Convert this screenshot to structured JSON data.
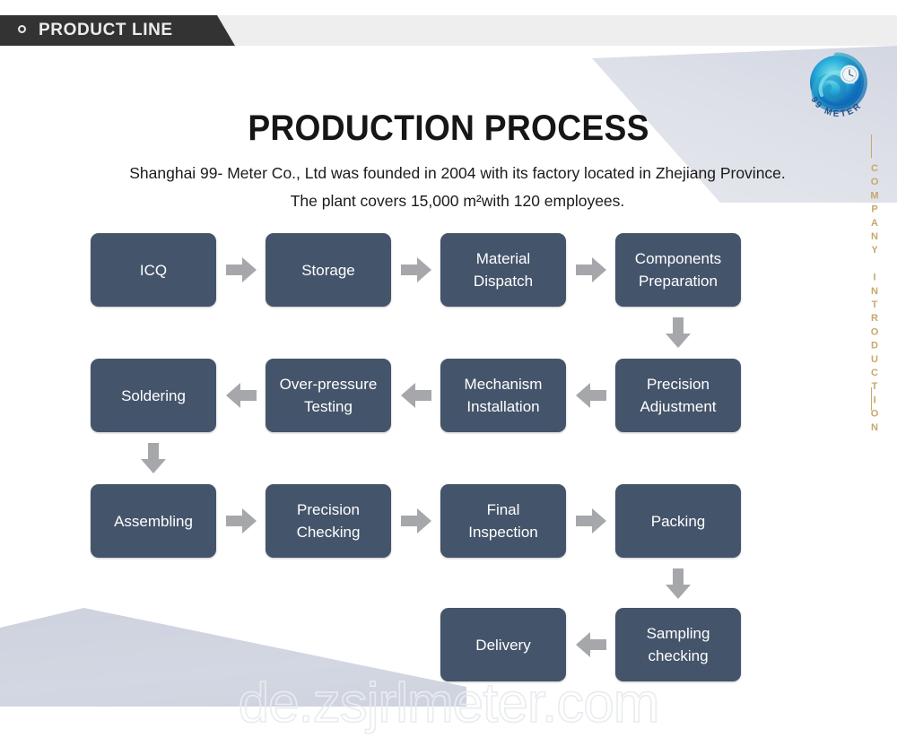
{
  "header": {
    "label": "PRODUCT LINE",
    "bullet_icon": "ring-icon",
    "bar_color": "#333333",
    "band_color": "#eeeeee"
  },
  "brand": {
    "logo_icon": "99meter-swirl-logo",
    "logo_text": "99 METER",
    "logo_color": "#1a9fd4"
  },
  "rail": {
    "text": "COMPANY INTRODUCTION",
    "color": "#c8a76b"
  },
  "page": {
    "title": "PRODUCTION PROCESS",
    "subtitle": "Shanghai 99- Meter Co., Ltd was founded in 2004 with its factory located in Zhejiang Province. The plant covers 15,000 m²with 120 employees.",
    "watermark": "de.zsjrlmeter.com",
    "box_color": "#44546a",
    "arrow_color": "#a6a7ab"
  },
  "flow": {
    "rows": [
      {
        "direction": "right",
        "steps": [
          {
            "label": "ICQ"
          },
          {
            "label": "Storage"
          },
          {
            "label": "Material\nDispatch"
          },
          {
            "label": "Components\nPreparation"
          }
        ]
      },
      {
        "direction": "left",
        "steps": [
          {
            "label": "Soldering"
          },
          {
            "label": "Over-pressure\nTesting"
          },
          {
            "label": "Mechanism\nInstallation"
          },
          {
            "label": "Precision\nAdjustment"
          }
        ]
      },
      {
        "direction": "right",
        "steps": [
          {
            "label": "Assembling"
          },
          {
            "label": "Precision\nChecking"
          },
          {
            "label": "Final\nInspection"
          },
          {
            "label": "Packing"
          }
        ]
      },
      {
        "direction": "left",
        "steps": [
          {
            "label": "Delivery"
          },
          {
            "label": "Sampling\nchecking"
          }
        ]
      }
    ],
    "connectors": [
      {
        "name": "down-arrow-components-to-precision",
        "icon": "arrow-down-icon"
      },
      {
        "name": "down-arrow-soldering-to-assembling",
        "icon": "arrow-down-icon"
      },
      {
        "name": "down-arrow-packing-to-sampling",
        "icon": "arrow-down-icon"
      }
    ]
  }
}
